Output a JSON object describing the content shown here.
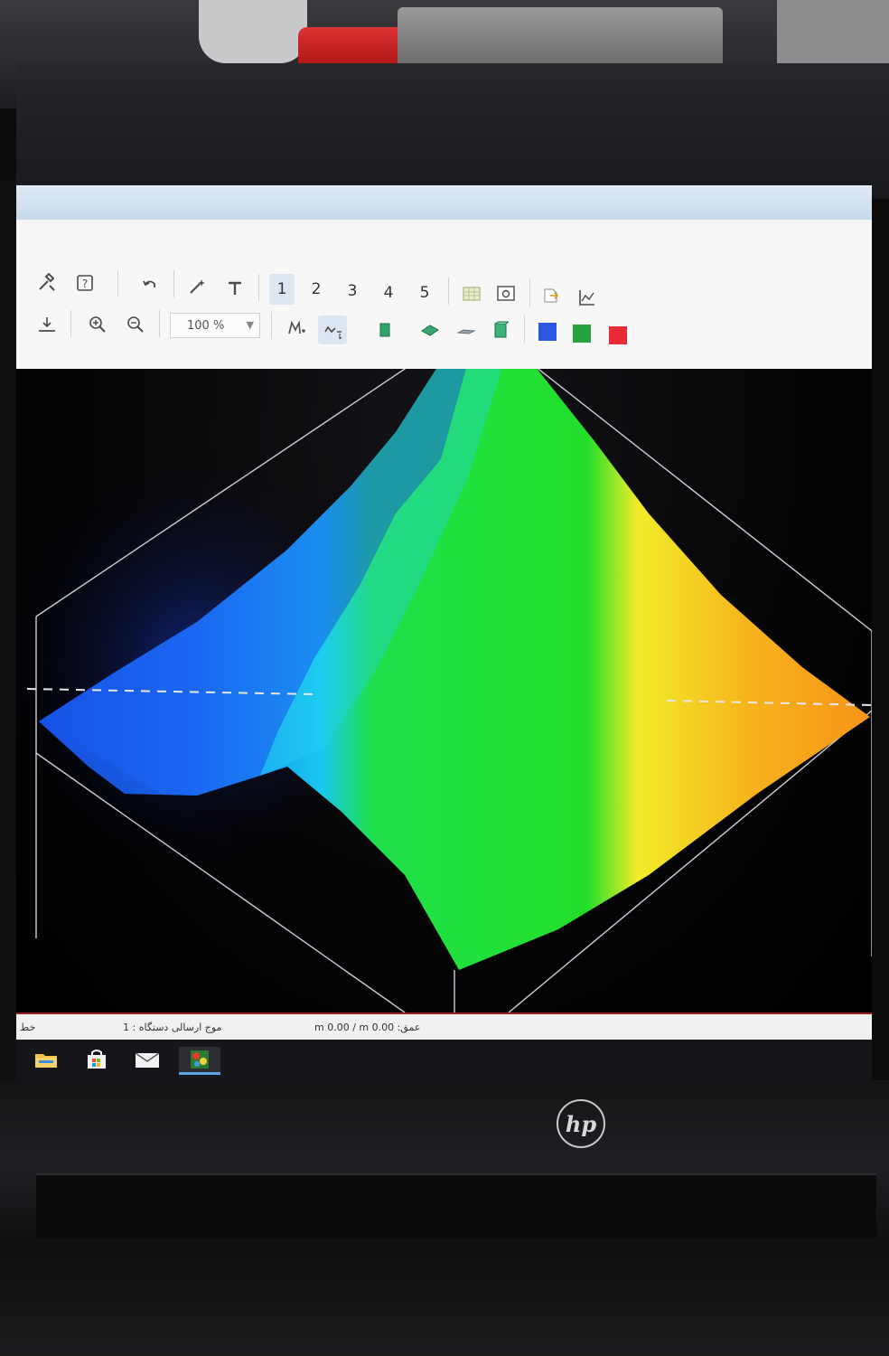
{
  "toolbar": {
    "row1": {
      "tools_icon": "tools-icon",
      "help_icon": "help-icon",
      "undo_icon": "undo-icon",
      "magic_icon": "magic-wand-icon",
      "text_icon": "text-tool-icon",
      "pages": [
        "1",
        "2",
        "3",
        "4",
        "5"
      ],
      "selected_page": "1"
    },
    "row2": {
      "zoom_value": "100 %",
      "swatch_colors": [
        "#2b57e0",
        "#27a23f",
        "#e82b36"
      ]
    }
  },
  "status": {
    "line_label": "خط",
    "device_label": "موج ارسالی دستگاه : 1",
    "depth_label": "عمق: m 0.00 / m 0.00"
  },
  "brand": {
    "logo": "hp"
  },
  "colors": {
    "accent_red": "#9b1d22",
    "surface_blue": "#1f5fe8",
    "surface_green": "#21e02b",
    "surface_yellow": "#f4e828",
    "surface_orange": "#f7a21a"
  }
}
